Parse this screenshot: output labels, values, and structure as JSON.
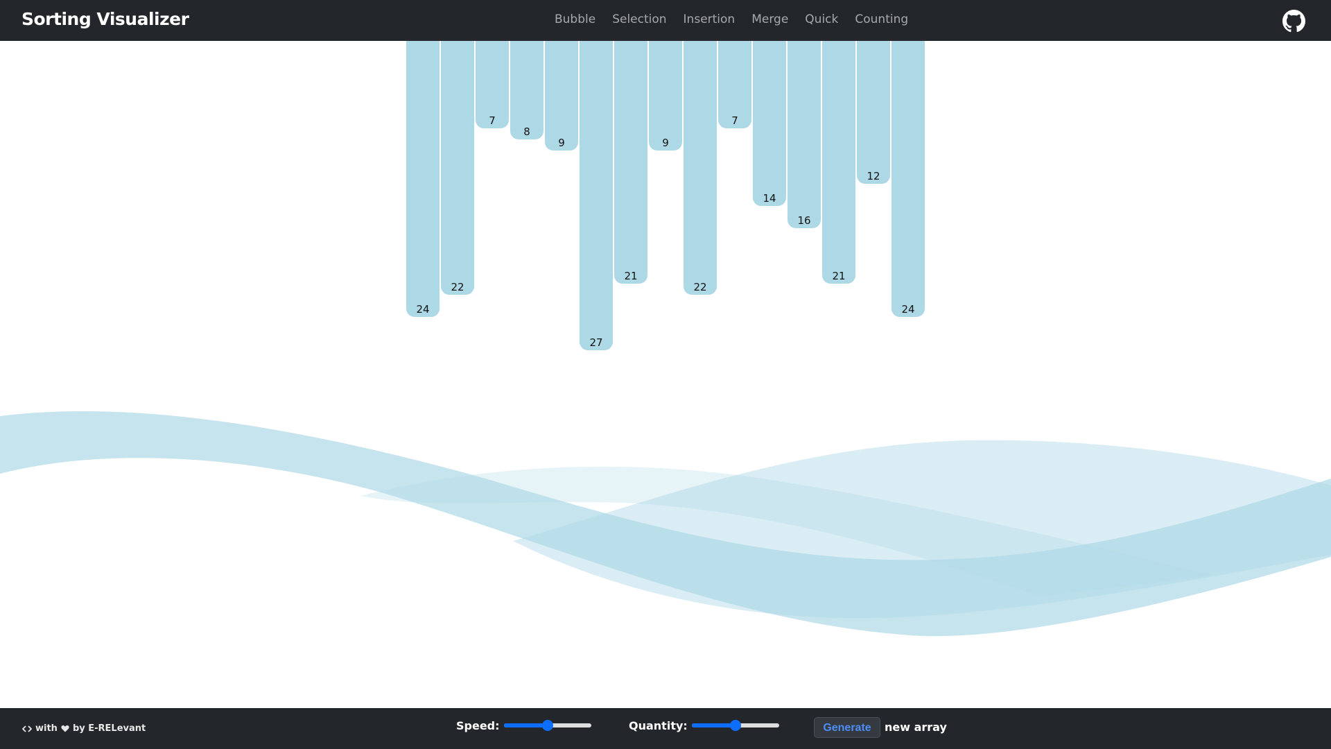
{
  "navbar": {
    "brand": "Sorting Visualizer",
    "links": [
      "Bubble",
      "Selection",
      "Insertion",
      "Merge",
      "Quick",
      "Counting"
    ],
    "github_icon": "github-icon"
  },
  "array": {
    "values": [
      24,
      22,
      7,
      8,
      9,
      27,
      21,
      9,
      22,
      7,
      14,
      16,
      21,
      12,
      24
    ],
    "bar_color": "#add8e6"
  },
  "footer": {
    "credit_icon": "code-icon",
    "credit_with": "with",
    "credit_heart_icon": "heart-icon",
    "credit_by": "by E-RELevant",
    "speed_label": "Speed:",
    "speed_value": 0.5,
    "quantity_label": "Quantity:",
    "quantity_value": 0.5,
    "generate_label": "Generate",
    "generate_suffix": "new array"
  },
  "colors": {
    "navbar_bg": "#23272b",
    "accent": "#0d6efd",
    "wave": "#add8e6"
  }
}
